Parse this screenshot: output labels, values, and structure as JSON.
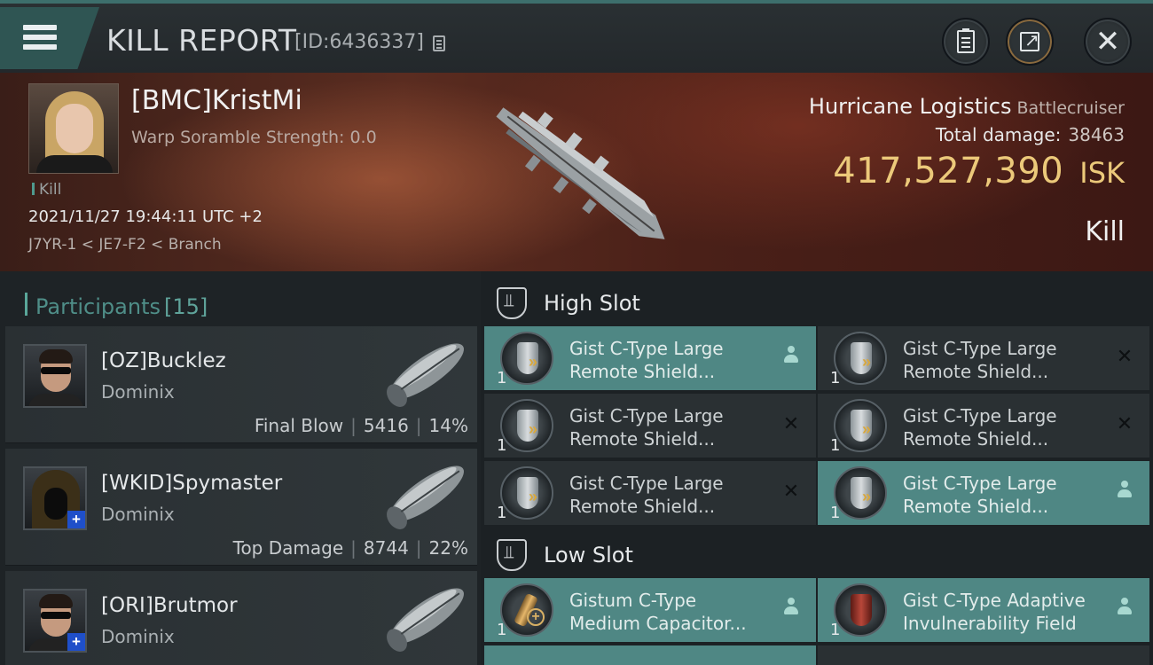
{
  "header": {
    "title": "KILL REPORT",
    "id_text": "[ID:6436337]"
  },
  "victim": {
    "name": "[BMC]KristMi",
    "scramble": "Warp Soramble Strength: 0.0",
    "tag": "Kill",
    "datetime": "2021/11/27 19:44:11 UTC +2",
    "location": "J7YR-1 < JE7-F2 < Branch",
    "ship_name": "Hurricane Logistics",
    "ship_class": "Battlecruiser",
    "total_damage_label": "Total damage:",
    "total_damage_value": "38463",
    "isk_value": "417,527,390",
    "isk_unit": "ISK",
    "result": "Kill"
  },
  "participants": {
    "title": "Participants",
    "count": "[15]",
    "rows": [
      {
        "name": "[OZ]Bucklez",
        "ship": "Dominix",
        "role": "Final Blow",
        "damage": "5416",
        "percent": "14%"
      },
      {
        "name": "[WKID]Spymaster",
        "ship": "Dominix",
        "role": "Top Damage",
        "damage": "8744",
        "percent": "22%"
      },
      {
        "name": "[ORI]Brutmor",
        "ship": "Dominix",
        "role": "",
        "damage": "",
        "percent": ""
      }
    ]
  },
  "high_slot": {
    "title": "High Slot",
    "modules": [
      {
        "qty": "1",
        "line1": "Gist C-Type Large",
        "line2": "Remote Shield...",
        "status": "person-icon",
        "active": true
      },
      {
        "qty": "1",
        "line1": "Gist C-Type Large",
        "line2": "Remote Shield...",
        "status": "close-icon",
        "active": false
      },
      {
        "qty": "1",
        "line1": "Gist C-Type Large",
        "line2": "Remote Shield...",
        "status": "close-icon",
        "active": false
      },
      {
        "qty": "1",
        "line1": "Gist C-Type Large",
        "line2": "Remote Shield...",
        "status": "close-icon",
        "active": false
      },
      {
        "qty": "1",
        "line1": "Gist C-Type Large",
        "line2": "Remote Shield...",
        "status": "close-icon",
        "active": false
      },
      {
        "qty": "1",
        "line1": "Gist C-Type Large",
        "line2": "Remote Shield...",
        "status": "person-icon",
        "active": true
      }
    ]
  },
  "low_slot": {
    "title": "Low Slot",
    "modules": [
      {
        "qty": "1",
        "line1": "Gistum C-Type",
        "line2": "Medium Capacitor...",
        "status": "person-icon",
        "active": true
      },
      {
        "qty": "1",
        "line1": "Gist C-Type Adaptive",
        "line2": "Invulnerability Field",
        "status": "person-icon",
        "active": true
      }
    ]
  },
  "colors": {
    "accent": "#4f8784",
    "isk": "#ecc97a",
    "banner": "#5a2c20"
  }
}
